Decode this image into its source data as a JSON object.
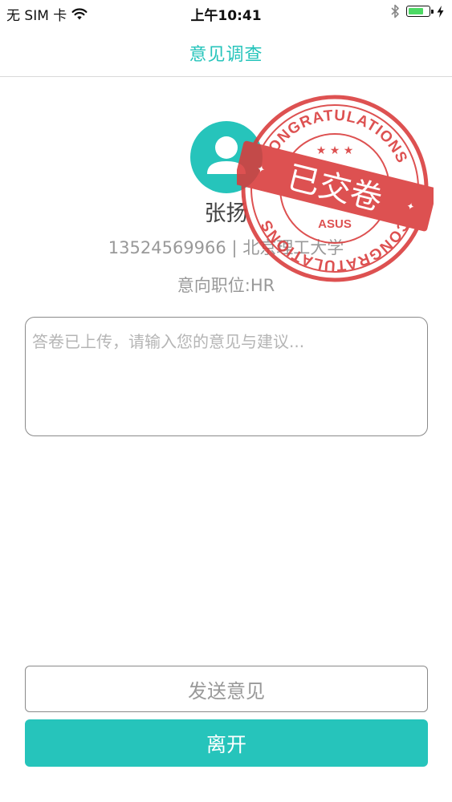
{
  "status_bar": {
    "carrier": "无 SIM 卡",
    "time": "上午10:41",
    "battery_level": 0.8
  },
  "nav": {
    "title": "意见调查"
  },
  "profile": {
    "name": "张扬",
    "phone": "13524569966",
    "separator": "|",
    "school": "北京理工大学",
    "position": "意向职位:HR"
  },
  "stamp": {
    "top_text": "CONGRATULATIONS",
    "bottom_text": "CONGRATULATIONS",
    "banner_text": "已交卷",
    "brand": "ASUS",
    "color": "#d93a3a"
  },
  "feedback": {
    "placeholder": "答卷已上传，请输入您的意见与建议...",
    "value": ""
  },
  "buttons": {
    "send_label": "发送意见",
    "leave_label": "离开"
  },
  "colors": {
    "accent": "#26c4bb",
    "stamp_red": "#d93a3a"
  },
  "icons": {
    "wifi": "wifi-icon",
    "bluetooth": "bluetooth-icon",
    "battery": "battery-icon",
    "charging": "charging-icon",
    "avatar": "user-avatar-icon"
  }
}
